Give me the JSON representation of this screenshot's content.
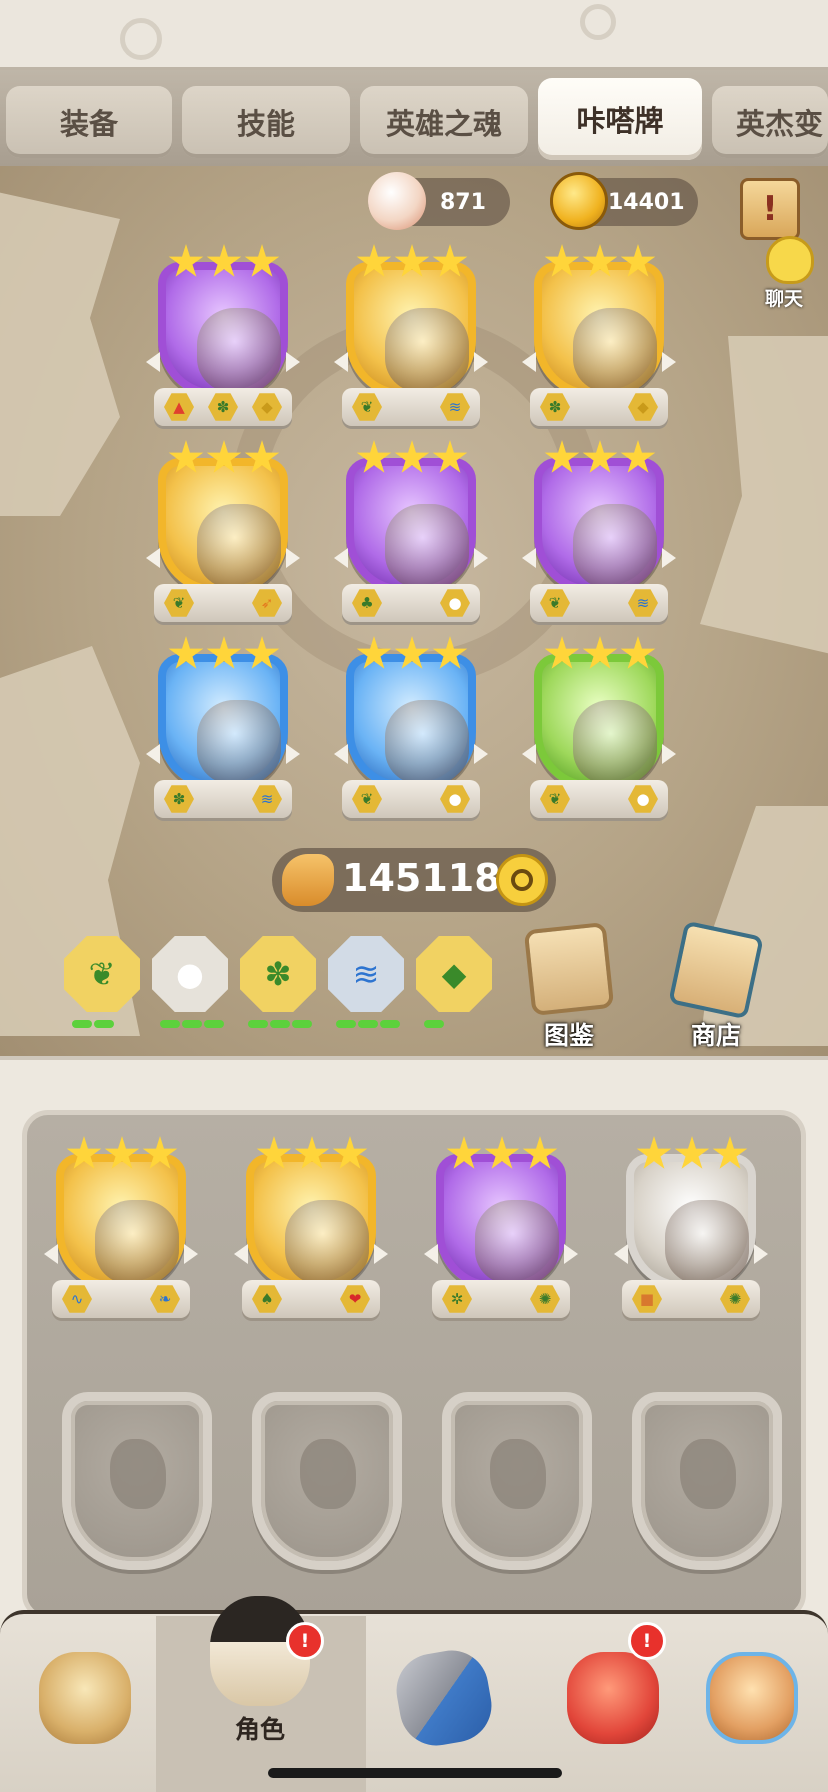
{
  "tabs": [
    {
      "label": "装备"
    },
    {
      "label": "技能"
    },
    {
      "label": "英雄之魂"
    },
    {
      "label": "咔嗒牌"
    },
    {
      "label": "英杰变"
    }
  ],
  "currency": {
    "shells": "871",
    "coins": "14401"
  },
  "chat": {
    "label": "聊天"
  },
  "top_cards": [
    {
      "rarity": "purple",
      "stars": 3,
      "badges": [
        "lava-icon",
        "cactus-icon",
        "shield-icon"
      ]
    },
    {
      "rarity": "gold",
      "stars": 3,
      "badges": [
        "leaf-icon",
        "tornado-icon"
      ]
    },
    {
      "rarity": "gold",
      "stars": 3,
      "badges": [
        "cactus-icon",
        "shield-icon"
      ]
    },
    {
      "rarity": "gold",
      "stars": 3,
      "badges": [
        "leaf-icon",
        "claw-icon"
      ]
    },
    {
      "rarity": "purple",
      "stars": 3,
      "badges": [
        "grass-icon",
        "cotton-icon"
      ]
    },
    {
      "rarity": "purple",
      "stars": 3,
      "badges": [
        "leaf-icon",
        "tornado-icon"
      ]
    },
    {
      "rarity": "blue",
      "stars": 3,
      "badges": [
        "cactus-icon",
        "tornado-icon"
      ]
    },
    {
      "rarity": "blue",
      "stars": 3,
      "badges": [
        "leaf-icon",
        "cotton-icon"
      ]
    },
    {
      "rarity": "green",
      "stars": 3,
      "badges": [
        "leaf-icon",
        "cotton-icon"
      ]
    }
  ],
  "power": {
    "value": "145118"
  },
  "bonds": [
    {
      "icon": "leaf-icon",
      "levels": 2
    },
    {
      "icon": "cotton-icon",
      "levels": 3
    },
    {
      "icon": "cactus-icon",
      "levels": 3
    },
    {
      "icon": "tornado-icon",
      "levels": 3
    },
    {
      "icon": "shield-icon",
      "levels": 1
    }
  ],
  "actions": {
    "codex": "图鉴",
    "shop": "商店"
  },
  "team_cards": [
    {
      "rarity": "gold",
      "stars": 3,
      "badges": [
        "wave-icon",
        "wing-icon"
      ]
    },
    {
      "rarity": "gold",
      "stars": 3,
      "badges": [
        "tree-icon",
        "lips-icon"
      ]
    },
    {
      "rarity": "purple",
      "stars": 3,
      "badges": [
        "palm-icon",
        "splat-icon"
      ]
    },
    {
      "rarity": "white",
      "stars": 3,
      "badges": [
        "rock-icon",
        "splat-icon"
      ]
    }
  ],
  "nav": {
    "character": "角色"
  },
  "colors": {
    "gold": "#f2b62a",
    "purple": "#a04fd6",
    "blue": "#3d8fe6",
    "green": "#7cc93a",
    "white": "#d9d5cf",
    "star": "#ffd53a",
    "bond_active": "#5cd13c"
  }
}
